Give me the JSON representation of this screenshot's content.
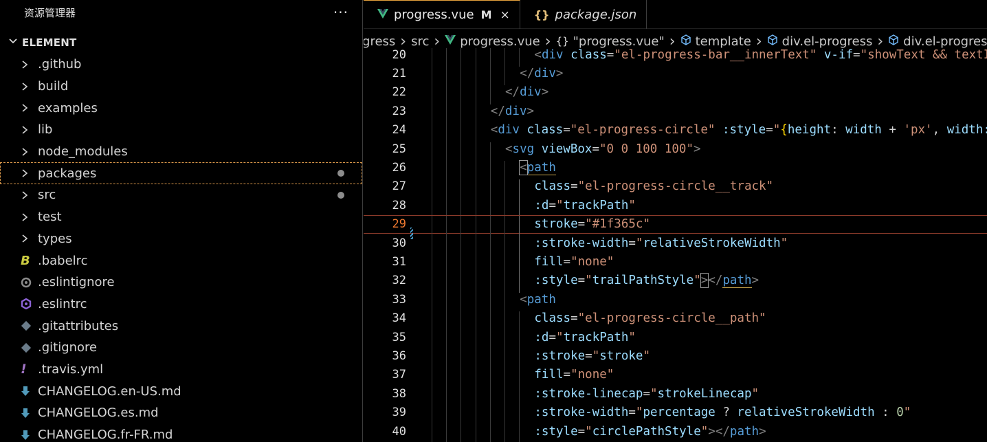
{
  "sidebar": {
    "title": "资源管理器",
    "more_icon": "ellipsis-icon",
    "section_title": "ELEMENT",
    "items": [
      {
        "label": ".github",
        "kind": "folder"
      },
      {
        "label": "build",
        "kind": "folder"
      },
      {
        "label": "examples",
        "kind": "folder"
      },
      {
        "label": "lib",
        "kind": "folder"
      },
      {
        "label": "node_modules",
        "kind": "folder"
      },
      {
        "label": "packages",
        "kind": "folder",
        "modified": true,
        "focused": true
      },
      {
        "label": "src",
        "kind": "folder",
        "modified": true
      },
      {
        "label": "test",
        "kind": "folder"
      },
      {
        "label": "types",
        "kind": "folder"
      },
      {
        "label": ".babelrc",
        "kind": "babel",
        "icon": "babel-icon",
        "color": "#cbcb41"
      },
      {
        "label": ".eslintignore",
        "kind": "eslintignore",
        "icon": "eslint-ignore-icon",
        "color": "#8a8a8a"
      },
      {
        "label": ".eslintrc",
        "kind": "eslint",
        "icon": "eslint-icon",
        "color": "#8c63d6"
      },
      {
        "label": ".gitattributes",
        "kind": "git",
        "icon": "git-icon",
        "color": "#6a7b89"
      },
      {
        "label": ".gitignore",
        "kind": "git",
        "icon": "git-icon",
        "color": "#6a7b89"
      },
      {
        "label": ".travis.yml",
        "kind": "yaml",
        "icon": "exclamation-icon",
        "color": "#a074c4"
      },
      {
        "label": "CHANGELOG.en-US.md",
        "kind": "md",
        "icon": "markdown-icon",
        "color": "#519aba"
      },
      {
        "label": "CHANGELOG.es.md",
        "kind": "md",
        "icon": "markdown-icon",
        "color": "#519aba"
      },
      {
        "label": "CHANGELOG.fr-FR.md",
        "kind": "md",
        "icon": "markdown-icon",
        "color": "#519aba"
      }
    ]
  },
  "tabs": [
    {
      "label": "progress.vue",
      "icon": "vue-icon",
      "badge": "M",
      "active": true,
      "close": "×"
    },
    {
      "label": "package.json",
      "icon": "json-icon",
      "icon_text": "{}",
      "active": false
    }
  ],
  "breadcrumb": {
    "items": [
      {
        "label": "ogress",
        "icon": ""
      },
      {
        "label": "src",
        "icon": ""
      },
      {
        "label": "progress.vue",
        "icon": "vue-icon"
      },
      {
        "label": "\"progress.vue\"",
        "icon": "braces-icon",
        "icon_text": "{}"
      },
      {
        "label": "template",
        "icon": "cube-icon"
      },
      {
        "label": "div.el-progress",
        "icon": "cube-icon"
      },
      {
        "label": "div.el-progress-c",
        "icon": "cube-icon"
      }
    ]
  },
  "colors": {
    "vue_green": "#41b883",
    "json_yellow": "#e5c07b",
    "cube_blue": "#75beff",
    "modified_line_number": "#f07a30"
  },
  "code": {
    "cursor_line": 29,
    "lines": [
      {
        "n": "20",
        "indent": 7,
        "tokens": [
          [
            "br",
            "<"
          ],
          [
            "tag",
            "div"
          ],
          [
            "op",
            " "
          ],
          [
            "attr",
            "class"
          ],
          [
            "eq",
            "="
          ],
          [
            "str",
            "\"el-progress-bar__innerText\""
          ],
          [
            "op",
            " "
          ],
          [
            "attr",
            "v-if"
          ],
          [
            "eq",
            "="
          ],
          [
            "str",
            "\"showText && textI"
          ]
        ]
      },
      {
        "n": "21",
        "indent": 6,
        "tokens": [
          [
            "br",
            "</"
          ],
          [
            "tag",
            "div"
          ],
          [
            "br",
            ">"
          ]
        ]
      },
      {
        "n": "22",
        "indent": 5,
        "tokens": [
          [
            "br",
            "</"
          ],
          [
            "tag",
            "div"
          ],
          [
            "br",
            ">"
          ]
        ]
      },
      {
        "n": "23",
        "indent": 4,
        "tokens": [
          [
            "br",
            "</"
          ],
          [
            "tag",
            "div"
          ],
          [
            "br",
            ">"
          ]
        ]
      },
      {
        "n": "24",
        "indent": 4,
        "tokens": [
          [
            "br",
            "<"
          ],
          [
            "tag",
            "div"
          ],
          [
            "op",
            " "
          ],
          [
            "attr",
            "class"
          ],
          [
            "eq",
            "="
          ],
          [
            "str",
            "\"el-progress-circle\""
          ],
          [
            "op",
            " "
          ],
          [
            "attr",
            ":style"
          ],
          [
            "eq",
            "="
          ],
          [
            "str",
            "\""
          ],
          [
            "brace",
            "{"
          ],
          [
            "attr",
            "height"
          ],
          [
            "op",
            ": "
          ],
          [
            "attr",
            "width"
          ],
          [
            "op",
            " + "
          ],
          [
            "str",
            "'px'"
          ],
          [
            "op",
            ", "
          ],
          [
            "attr",
            "width:"
          ]
        ]
      },
      {
        "n": "25",
        "indent": 5,
        "tokens": [
          [
            "br",
            "<"
          ],
          [
            "tag",
            "svg"
          ],
          [
            "op",
            " "
          ],
          [
            "attr",
            "viewBox"
          ],
          [
            "eq",
            "="
          ],
          [
            "str",
            "\"0 0 100 100\""
          ],
          [
            "br",
            ">"
          ]
        ]
      },
      {
        "n": "26",
        "indent": 6,
        "tokens": [
          [
            "brhl",
            "<"
          ],
          [
            "tagu",
            "path"
          ]
        ]
      },
      {
        "n": "27",
        "indent": 7,
        "tokens": [
          [
            "attr",
            "class"
          ],
          [
            "eq",
            "="
          ],
          [
            "str",
            "\"el-progress-circle__track\""
          ]
        ]
      },
      {
        "n": "28",
        "indent": 7,
        "tokens": [
          [
            "attr",
            ":d"
          ],
          [
            "eq",
            "="
          ],
          [
            "str",
            "\""
          ],
          [
            "attr",
            "trackPath"
          ],
          [
            "str",
            "\""
          ]
        ]
      },
      {
        "n": "29",
        "indent": 7,
        "tokens": [
          [
            "attr",
            "stroke"
          ],
          [
            "eq",
            "="
          ],
          [
            "str",
            "\"#1f365c\""
          ]
        ]
      },
      {
        "n": "30",
        "indent": 7,
        "tokens": [
          [
            "attr",
            ":stroke-width"
          ],
          [
            "eq",
            "="
          ],
          [
            "str",
            "\""
          ],
          [
            "attr",
            "relativeStrokeWidth"
          ],
          [
            "str",
            "\""
          ]
        ]
      },
      {
        "n": "31",
        "indent": 7,
        "tokens": [
          [
            "attr",
            "fill"
          ],
          [
            "eq",
            "="
          ],
          [
            "str",
            "\"none\""
          ]
        ]
      },
      {
        "n": "32",
        "indent": 7,
        "tokens": [
          [
            "attr",
            ":style"
          ],
          [
            "eq",
            "="
          ],
          [
            "str",
            "\""
          ],
          [
            "attr",
            "trailPathStyle"
          ],
          [
            "str",
            "\""
          ],
          [
            "brhl",
            ">"
          ],
          [
            "br",
            "</"
          ],
          [
            "tagu",
            "path"
          ],
          [
            "br",
            ">"
          ]
        ]
      },
      {
        "n": "33",
        "indent": 6,
        "tokens": [
          [
            "br",
            "<"
          ],
          [
            "tag",
            "path"
          ]
        ]
      },
      {
        "n": "34",
        "indent": 7,
        "tokens": [
          [
            "attr",
            "class"
          ],
          [
            "eq",
            "="
          ],
          [
            "str",
            "\"el-progress-circle__path\""
          ]
        ]
      },
      {
        "n": "35",
        "indent": 7,
        "tokens": [
          [
            "attr",
            ":d"
          ],
          [
            "eq",
            "="
          ],
          [
            "str",
            "\""
          ],
          [
            "attr",
            "trackPath"
          ],
          [
            "str",
            "\""
          ]
        ]
      },
      {
        "n": "36",
        "indent": 7,
        "tokens": [
          [
            "attr",
            ":stroke"
          ],
          [
            "eq",
            "="
          ],
          [
            "str",
            "\""
          ],
          [
            "attr",
            "stroke"
          ],
          [
            "str",
            "\""
          ]
        ]
      },
      {
        "n": "37",
        "indent": 7,
        "tokens": [
          [
            "attr",
            "fill"
          ],
          [
            "eq",
            "="
          ],
          [
            "str",
            "\"none\""
          ]
        ]
      },
      {
        "n": "38",
        "indent": 7,
        "tokens": [
          [
            "attr",
            ":stroke-linecap"
          ],
          [
            "eq",
            "="
          ],
          [
            "str",
            "\""
          ],
          [
            "attr",
            "strokeLinecap"
          ],
          [
            "str",
            "\""
          ]
        ]
      },
      {
        "n": "39",
        "indent": 7,
        "tokens": [
          [
            "attr",
            ":stroke-width"
          ],
          [
            "eq",
            "="
          ],
          [
            "str",
            "\""
          ],
          [
            "attr",
            "percentage"
          ],
          [
            "op",
            " ? "
          ],
          [
            "attr",
            "relativeStrokeWidth"
          ],
          [
            "op",
            " : "
          ],
          [
            "num",
            "0"
          ],
          [
            "str",
            "\""
          ]
        ]
      },
      {
        "n": "40",
        "indent": 7,
        "tokens": [
          [
            "attr",
            ":style"
          ],
          [
            "eq",
            "="
          ],
          [
            "str",
            "\""
          ],
          [
            "attr",
            "circlePathStyle"
          ],
          [
            "str",
            "\""
          ],
          [
            "br",
            "></"
          ],
          [
            "tag",
            "path"
          ],
          [
            "br",
            ">"
          ]
        ]
      }
    ]
  }
}
